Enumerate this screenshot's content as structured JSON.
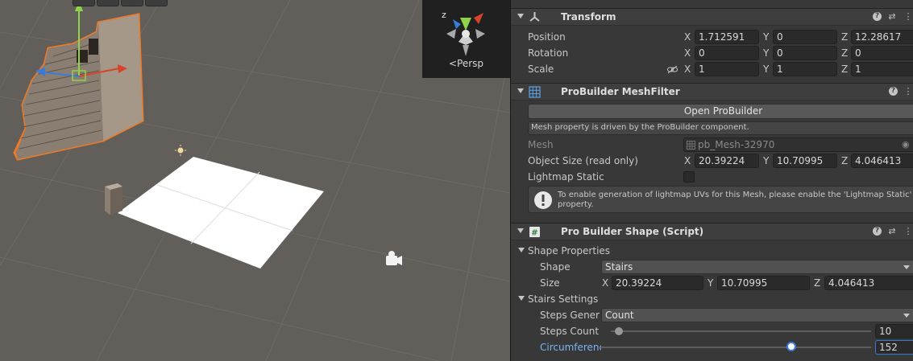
{
  "scene": {
    "view_mode": "Persp",
    "gizmo_axes": {
      "x_color": "#d7432b",
      "y_color": "#8ed34a",
      "z_color": "#3a7bd5",
      "z_label": "z"
    }
  },
  "transform": {
    "title": "Transform",
    "position": {
      "label": "Position",
      "x": "1.712591",
      "y": "0",
      "z": "12.28617"
    },
    "rotation": {
      "label": "Rotation",
      "x": "0",
      "y": "0",
      "z": "0"
    },
    "scale": {
      "label": "Scale",
      "x": "1",
      "y": "1",
      "z": "1"
    },
    "axis_x": "X",
    "axis_y": "Y",
    "axis_z": "Z"
  },
  "meshfilter": {
    "title": "ProBuilder MeshFilter",
    "open_button": "Open ProBuilder",
    "driven_note": "Mesh property is driven by the ProBuilder component.",
    "mesh": {
      "label": "Mesh",
      "value": "pb_Mesh-32970"
    },
    "object_size": {
      "label": "Object Size (read only)",
      "x": "20.39224",
      "y": "10.70995",
      "z": "4.046413"
    },
    "lightmap_static": {
      "label": "Lightmap Static"
    },
    "lightmap_help": "To enable generation of lightmap UVs for this Mesh, please enable the 'Lightmap Static' property."
  },
  "shape": {
    "title": "Pro Builder Shape (Script)",
    "properties_label": "Shape Properties",
    "shape_field": {
      "label": "Shape",
      "value": "Stairs"
    },
    "size": {
      "label": "Size",
      "x": "20.39224",
      "y": "10.70995",
      "z": "4.046413"
    },
    "stairs_label": "Stairs Settings",
    "steps_generation": {
      "label": "Steps Genera",
      "value": "Count"
    },
    "steps_count": {
      "label": "Steps Count",
      "value": "10",
      "fraction": 0.03
    },
    "circumference": {
      "label": "Circumferenc",
      "value": "152",
      "fraction": 0.71
    }
  },
  "colors": {
    "accent": "#3a79d7",
    "selection_outline": "#f07a26",
    "scene_bg": "#625e59",
    "inspector_bg": "#383838"
  }
}
